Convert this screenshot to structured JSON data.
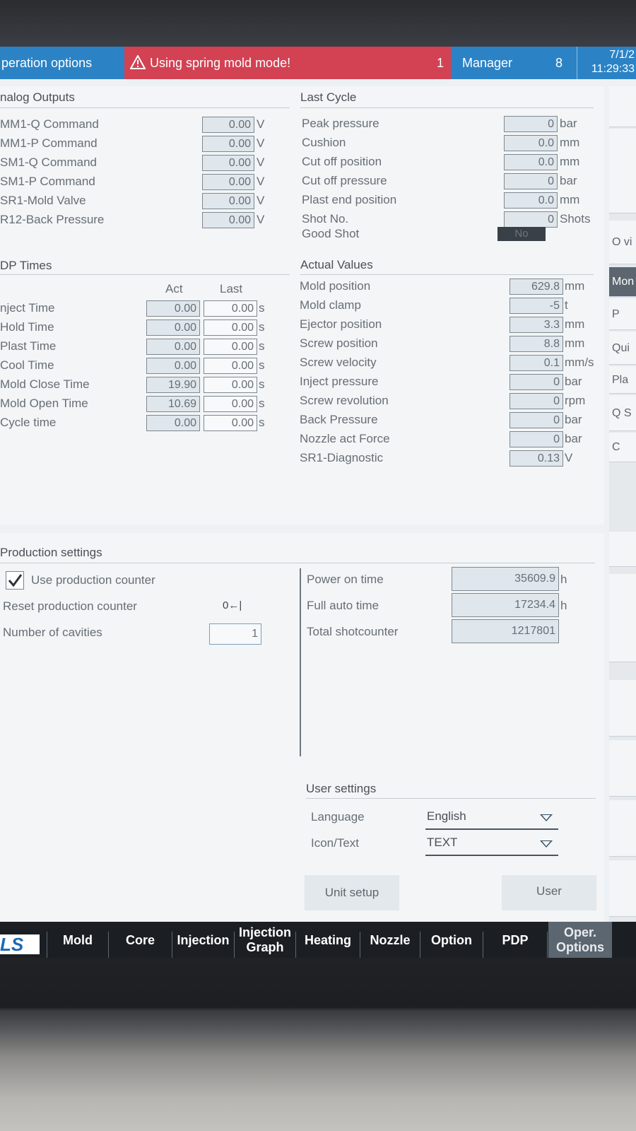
{
  "header": {
    "title": "peration options",
    "alert_text": "Using spring mold mode!",
    "alert_count": "1",
    "user_role": "Manager",
    "user_level": "8",
    "date": "7/1/2",
    "time": "11:29:33"
  },
  "analog_outputs": {
    "title": "nalog Outputs",
    "rows": [
      {
        "label": "MM1-Q Command",
        "value": "0.00",
        "unit": "V"
      },
      {
        "label": "MM1-P Command",
        "value": "0.00",
        "unit": "V"
      },
      {
        "label": "SM1-Q Command",
        "value": "0.00",
        "unit": "V"
      },
      {
        "label": "SM1-P Command",
        "value": "0.00",
        "unit": "V"
      },
      {
        "label": "SR1-Mold Valve",
        "value": "0.00",
        "unit": "V"
      },
      {
        "label": "R12-Back Pressure",
        "value": "0.00",
        "unit": "V"
      }
    ]
  },
  "last_cycle": {
    "title": "Last Cycle",
    "rows": [
      {
        "label": "Peak pressure",
        "value": "0",
        "unit": "bar"
      },
      {
        "label": "Cushion",
        "value": "0.0",
        "unit": "mm"
      },
      {
        "label": "Cut off position",
        "value": "0.0",
        "unit": "mm"
      },
      {
        "label": "Cut off pressure",
        "value": "0",
        "unit": "bar"
      },
      {
        "label": "Plast end position",
        "value": "0.0",
        "unit": "mm"
      },
      {
        "label": "Shot No.",
        "value": "0",
        "unit": "Shots"
      }
    ],
    "good_shot_label": "Good Shot",
    "good_shot_value": "No"
  },
  "pdp_times": {
    "title": "DP Times",
    "col_act": "Act",
    "col_last": "Last",
    "rows": [
      {
        "label": "nject Time",
        "act": "0.00",
        "last": "0.00",
        "unit": "s"
      },
      {
        "label": "Hold Time",
        "act": "0.00",
        "last": "0.00",
        "unit": "s"
      },
      {
        "label": "Plast Time",
        "act": "0.00",
        "last": "0.00",
        "unit": "s"
      },
      {
        "label": "Cool Time",
        "act": "0.00",
        "last": "0.00",
        "unit": "s"
      },
      {
        "label": "Mold Close Time",
        "act": "19.90",
        "last": "0.00",
        "unit": "s"
      },
      {
        "label": "Mold Open Time",
        "act": "10.69",
        "last": "0.00",
        "unit": "s"
      },
      {
        "label": "Cycle time",
        "act": "0.00",
        "last": "0.00",
        "unit": "s"
      }
    ]
  },
  "actual_values": {
    "title": "Actual Values",
    "rows": [
      {
        "label": "Mold position",
        "value": "629.8",
        "unit": "mm"
      },
      {
        "label": "Mold clamp",
        "value": "-5",
        "unit": "t"
      },
      {
        "label": "Ejector position",
        "value": "3.3",
        "unit": "mm"
      },
      {
        "label": "Screw position",
        "value": "8.8",
        "unit": "mm"
      },
      {
        "label": "Screw velocity",
        "value": "0.1",
        "unit": "mm/s"
      },
      {
        "label": "Inject pressure",
        "value": "0",
        "unit": "bar"
      },
      {
        "label": "Screw revolution",
        "value": "0",
        "unit": "rpm"
      },
      {
        "label": "Back Pressure",
        "value": "0",
        "unit": "bar"
      },
      {
        "label": "Nozzle act Force",
        "value": "0",
        "unit": "bar"
      },
      {
        "label": "SR1-Diagnostic",
        "value": "0.13",
        "unit": "V"
      }
    ]
  },
  "production": {
    "title": "Production settings",
    "use_counter_label": "Use production counter",
    "use_counter_checked": true,
    "reset_counter_label": "Reset production counter",
    "reset_button": "0←|",
    "cavities_label": "Number of cavities",
    "cavities_value": "1",
    "stats": [
      {
        "label": "Power on time",
        "value": "35609.9",
        "unit": "h"
      },
      {
        "label": "Full auto time",
        "value": "17234.4",
        "unit": "h"
      },
      {
        "label": "Total shotcounter",
        "value": "1217801",
        "unit": ""
      }
    ]
  },
  "user_settings": {
    "title": "User settings",
    "language_label": "Language",
    "language_value": "English",
    "icontext_label": "Icon/Text",
    "icontext_value": "TEXT",
    "unit_setup_button": "Unit setup",
    "user_button": "User"
  },
  "sidebar": {
    "items": [
      {
        "label": ""
      },
      {
        "label": ""
      },
      {
        "label": "O vi"
      },
      {
        "label": "Mon"
      },
      {
        "label": "P"
      },
      {
        "label": "Qui"
      },
      {
        "label": "Pla"
      },
      {
        "label": "Q S"
      },
      {
        "label": "C"
      }
    ]
  },
  "nav": {
    "logo": "LS",
    "items": [
      {
        "label": "Mold"
      },
      {
        "label": "Core"
      },
      {
        "label": "Injection"
      },
      {
        "label": "Injection Graph"
      },
      {
        "label": "Heating"
      },
      {
        "label": "Nozzle"
      },
      {
        "label": "Option"
      },
      {
        "label": "PDP"
      },
      {
        "label": "Oper. Options"
      }
    ],
    "selected": "Oper. Options"
  },
  "colors": {
    "header_blue": "#2b83c6",
    "alert_red": "#d24253",
    "nav_dark": "#1b1f24",
    "selected_gray": "#5c6670"
  }
}
